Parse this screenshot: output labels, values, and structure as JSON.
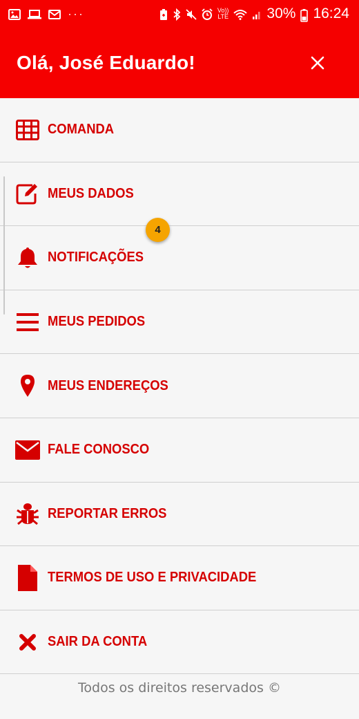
{
  "status_bar": {
    "battery": "30%",
    "time": "16:24",
    "volte_top": "Vo))",
    "volte_bottom": "LTE"
  },
  "header": {
    "greeting": "Olá, José Eduardo!"
  },
  "menu": {
    "items": [
      {
        "label": "COMANDA",
        "icon": "grid-icon"
      },
      {
        "label": "MEUS DADOS",
        "icon": "edit-icon"
      },
      {
        "label": "NOTIFICAÇÕES",
        "icon": "bell-icon"
      },
      {
        "label": "MEUS PEDIDOS",
        "icon": "list-icon"
      },
      {
        "label": "MEUS ENDEREÇOS",
        "icon": "map-pin-icon"
      },
      {
        "label": "FALE CONOSCO",
        "icon": "envelope-icon"
      },
      {
        "label": "REPORTAR ERROS",
        "icon": "bug-icon"
      },
      {
        "label": "TERMOS DE USO E PRIVACIDADE",
        "icon": "file-icon"
      },
      {
        "label": "SAIR DA CONTA",
        "icon": "x-icon"
      }
    ]
  },
  "notification_badge": "4",
  "footer": {
    "text": "Todos os direitos reservados ©"
  },
  "colors": {
    "primary": "#f50000",
    "label": "#d50000",
    "badge": "#f5a400",
    "background": "#f6f6f6"
  }
}
